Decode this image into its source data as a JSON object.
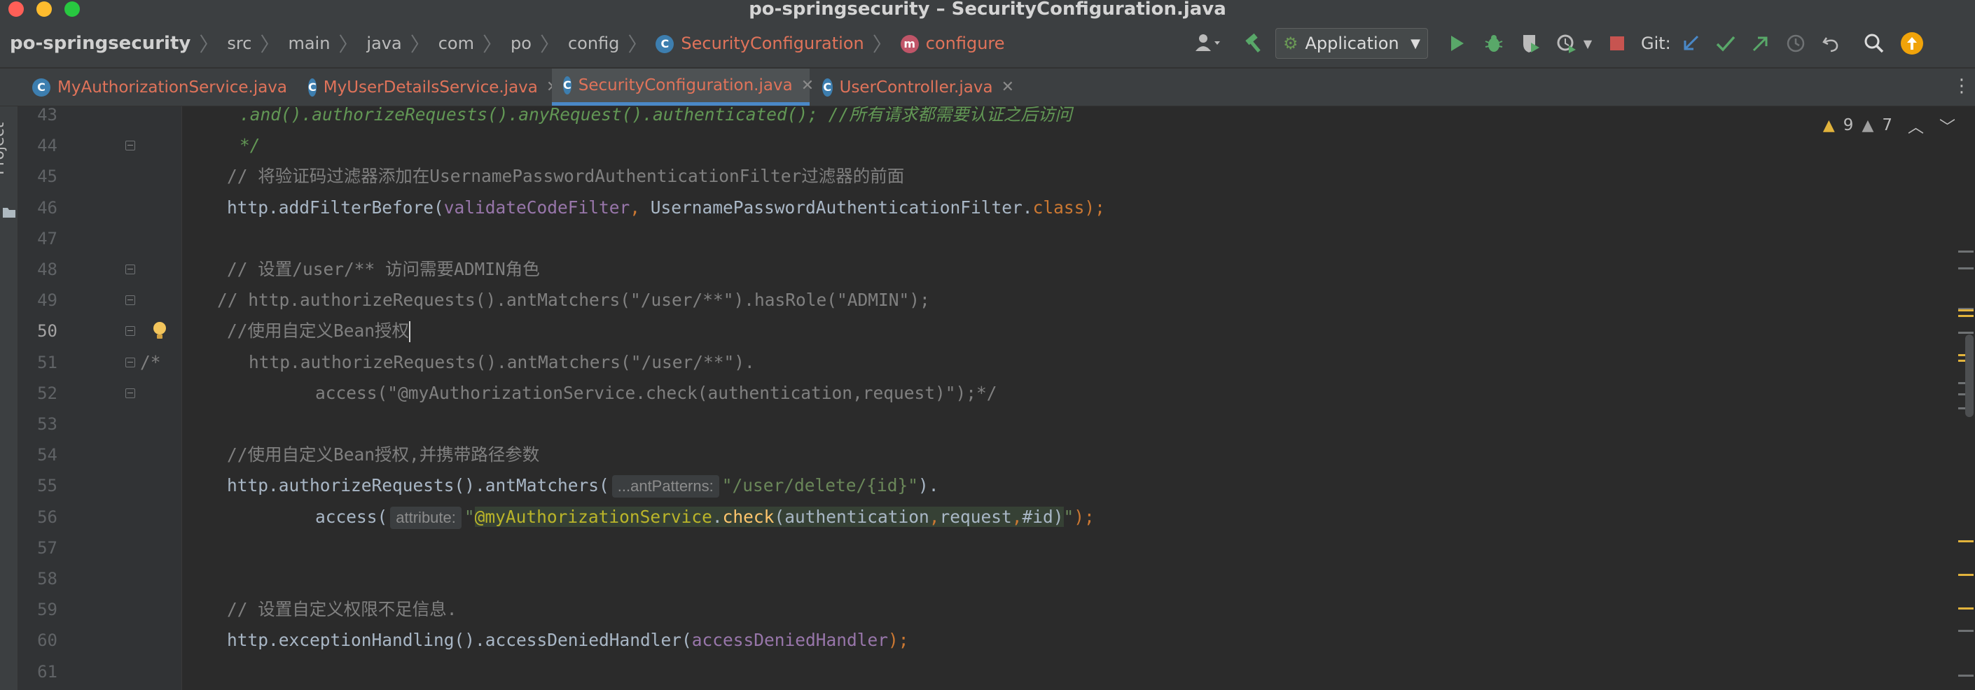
{
  "window": {
    "title": "po-springsecurity – SecurityConfiguration.java"
  },
  "breadcrumbs": {
    "project": "po-springsecurity",
    "items": [
      "src",
      "main",
      "java",
      "com",
      "po",
      "config"
    ],
    "class_name": "SecurityConfiguration",
    "method_name": "configure"
  },
  "toolbar": {
    "run_config": "Application",
    "git_label": "Git:"
  },
  "sidebar": {
    "project_label": "Project"
  },
  "tabs": [
    {
      "label": "MyAuthorizationService.java"
    },
    {
      "label": "MyUserDetailsService.java"
    },
    {
      "label": "SecurityConfiguration.java",
      "selected": true
    },
    {
      "label": "UserController.java"
    }
  ],
  "inspections": {
    "warnings": "9",
    "weak_warnings": "7"
  },
  "editor": {
    "current_line": "50",
    "lines": [
      {
        "num": "43",
        "segments": [
          {
            "t": ".and().authorizeRequests().anyRequest().authenticated(); //所有请求都需要认证之后访问",
            "c": "c-doc"
          }
        ]
      },
      {
        "num": "44",
        "segments": [
          {
            "t": "*/",
            "c": "c-doc"
          }
        ]
      },
      {
        "num": "45",
        "segments": [
          {
            "t": "// 将验证码过滤器添加在UsernamePasswordAuthenticationFilter过滤器的前面",
            "c": "c-comment"
          }
        ]
      },
      {
        "num": "46",
        "segments": [
          {
            "t": "http.addFilterBefore(",
            "c": ""
          },
          {
            "t": "validateCodeFilter",
            "c": "c-field"
          },
          {
            "t": ", ",
            "c": "c-kw"
          },
          {
            "t": "UsernamePasswordAuthenticationFilter.",
            "c": ""
          },
          {
            "t": "class",
            "c": "c-kw"
          },
          {
            "t": ");",
            "c": "c-kw"
          }
        ]
      },
      {
        "num": "47",
        "segments": []
      },
      {
        "num": "48",
        "segments": [
          {
            "t": "// 设置/user/** 访问需要ADMIN角色",
            "c": "c-comment"
          }
        ]
      },
      {
        "num": "49",
        "segments": [
          {
            "t": "// http.authorizeRequests().antMatchers(\"/user/**\").hasRole(\"ADMIN\");",
            "c": "c-comment"
          }
        ]
      },
      {
        "num": "50",
        "segments": [
          {
            "t": "//使用自定义Bean授权",
            "c": "c-comment"
          }
        ]
      },
      {
        "num": "51",
        "segments": [
          {
            "t": "http.authorizeRequests().antMatchers(\"/user/**\").",
            "c": "c-comment"
          }
        ]
      },
      {
        "num": "52",
        "segments": [
          {
            "t": "access(\"@myAuthorizationService.check(authentication,request)\");*/",
            "c": "c-comment"
          }
        ]
      },
      {
        "num": "53",
        "segments": []
      },
      {
        "num": "54",
        "segments": [
          {
            "t": "//使用自定义Bean授权,并携带路径参数",
            "c": "c-comment"
          }
        ]
      },
      {
        "num": "55",
        "segments": [
          {
            "t": "http.authorizeRequests().antMatchers(",
            "c": ""
          },
          {
            "hint": "...antPatterns:"
          },
          {
            "t": "\"/user/delete/{id}\"",
            "c": "c-str"
          },
          {
            "t": ").",
            "c": ""
          }
        ]
      },
      {
        "num": "56",
        "segments": [
          {
            "t": "access(",
            "c": ""
          },
          {
            "hint": "attribute:"
          },
          {
            "t": "\"",
            "c": "c-str"
          },
          {
            "t": "@myAuthorizationService",
            "c": "c-ann inj"
          },
          {
            "t": ".",
            "c": "inj"
          },
          {
            "t": "check",
            "c": "c-meth inj"
          },
          {
            "t": "(authentication",
            "c": "inj"
          },
          {
            "t": ",",
            "c": "c-kw inj"
          },
          {
            "t": "request",
            "c": "inj"
          },
          {
            "t": ",",
            "c": "c-kw inj"
          },
          {
            "t": "#id)",
            "c": "inj"
          },
          {
            "t": "\"",
            "c": "c-str"
          },
          {
            "t": ");",
            "c": "c-kw"
          }
        ]
      },
      {
        "num": "57",
        "segments": []
      },
      {
        "num": "58",
        "segments": []
      },
      {
        "num": "59",
        "segments": [
          {
            "t": "// 设置自定义权限不足信息.",
            "c": "c-comment"
          }
        ]
      },
      {
        "num": "60",
        "segments": [
          {
            "t": "http.exceptionHandling().accessDeniedHandler(",
            "c": ""
          },
          {
            "t": "accessDeniedHandler",
            "c": "c-field"
          },
          {
            "t": ");",
            "c": "c-kw"
          }
        ]
      },
      {
        "num": "61",
        "segments": []
      }
    ]
  }
}
